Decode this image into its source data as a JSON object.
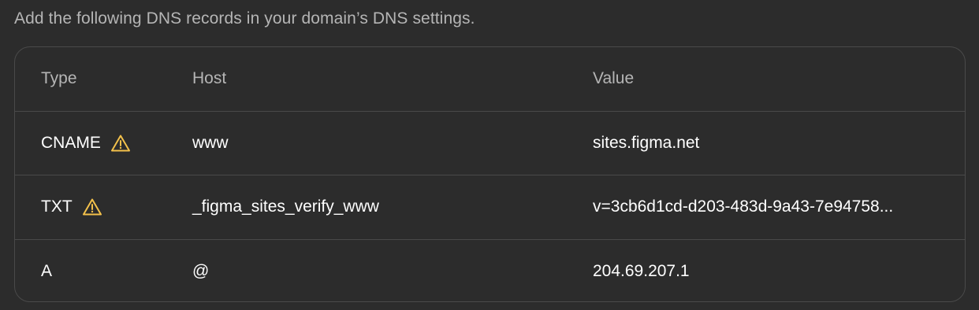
{
  "intro_text": "Add the following DNS records in your domain’s DNS settings.",
  "colors": {
    "background": "#2c2c2c",
    "border": "#4a4a4a",
    "muted_text": "#b5b5b5",
    "warning": "#f3c14b"
  },
  "table": {
    "headers": {
      "type": "Type",
      "host": "Host",
      "value": "Value"
    },
    "rows": [
      {
        "type": "CNAME",
        "warning": true,
        "warning_icon": "warning-icon",
        "host": "www",
        "value": "sites.figma.net"
      },
      {
        "type": "TXT",
        "warning": true,
        "warning_icon": "warning-icon",
        "host": "_figma_sites_verify_www",
        "value": "v=3cb6d1cd-d203-483d-9a43-7e94758..."
      },
      {
        "type": "A",
        "warning": false,
        "host": "@",
        "value": "204.69.207.1"
      }
    ]
  }
}
